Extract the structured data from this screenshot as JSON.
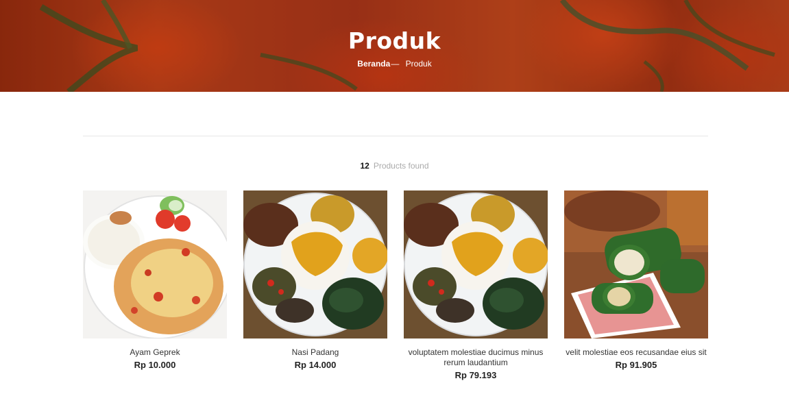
{
  "header": {
    "title": "Produk",
    "breadcrumb": {
      "home": "Beranda",
      "separator": "—",
      "current": "Produk"
    }
  },
  "results": {
    "count": "12",
    "label": "Products found"
  },
  "products": [
    {
      "name": "Ayam Geprek",
      "price": "Rp 10.000",
      "image": "ayam-geprek-image"
    },
    {
      "name": "Nasi Padang",
      "price": "Rp 14.000",
      "image": "nasi-padang-image"
    },
    {
      "name": "voluptatem molestiae ducimus minus rerum laudantium",
      "price": "Rp 79.193",
      "image": "nasi-padang-image"
    },
    {
      "name": "velit molestiae eos recusandae eius sit",
      "price": "Rp 91.905",
      "image": "lemper-image"
    }
  ],
  "colors": {
    "hero": "#b8421a",
    "price": "#222222",
    "muted": "#aaaaaa"
  }
}
